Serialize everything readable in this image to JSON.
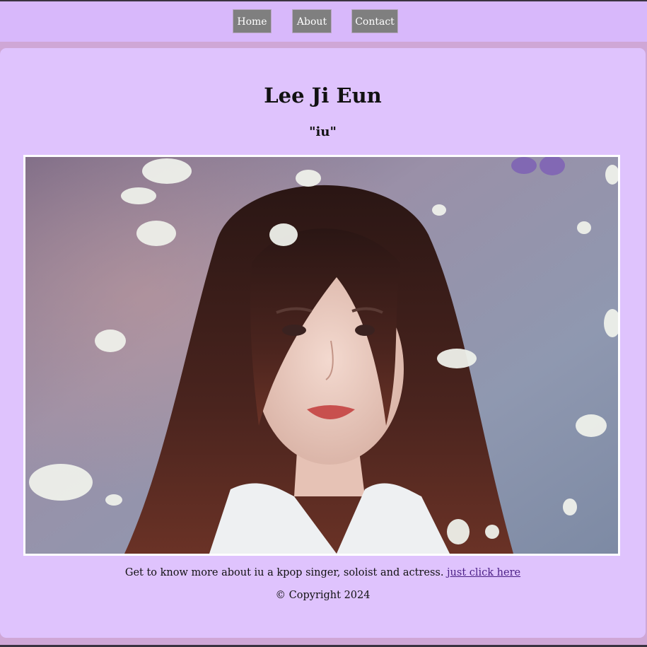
{
  "nav": {
    "home_label": "Home",
    "about_label": "About",
    "contact_label": "Contact"
  },
  "main": {
    "title": "Lee Ji Eun",
    "subtitle": "\"iu\"",
    "photo_alt": "iu portrait",
    "about_text": "Get to know more about iu a kpop singer, soloist and actress. ",
    "about_link": "just click here",
    "copyright": "© Copyright 2024"
  },
  "colors": {
    "nav_background": "#d8b8fb",
    "card_background": "#dfc3fd",
    "button_background": "#7f7f7f",
    "link_color": "#4b1f86"
  }
}
